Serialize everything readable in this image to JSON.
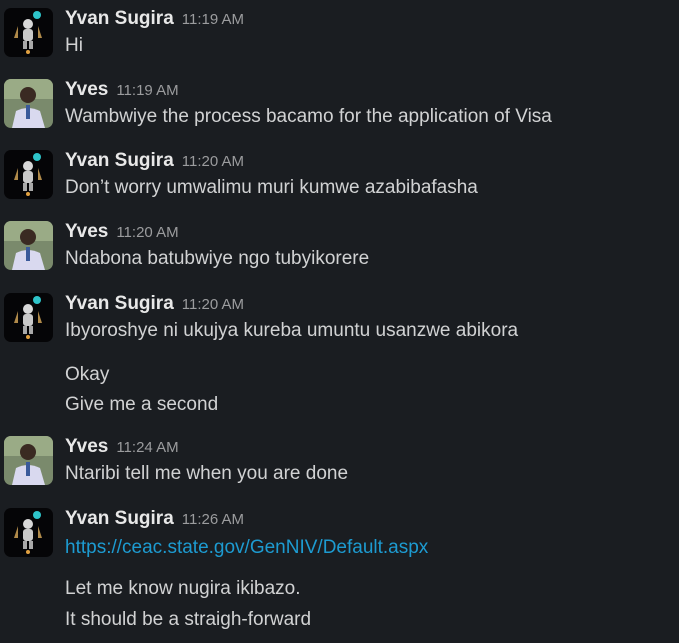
{
  "colors": {
    "background": "#1a1d21",
    "text": "#d1d2d3",
    "name": "#e8e8e8",
    "timestamp": "#9b9c9e",
    "link": "#1d9bd1"
  },
  "messages": [
    {
      "sender": "Yvan Sugira",
      "time": "11:19 AM",
      "avatar": "yvan-avatar",
      "lines": [
        "Hi"
      ]
    },
    {
      "sender": "Yves",
      "time": "11:19 AM",
      "avatar": "yves-avatar",
      "lines": [
        "Wambwiye the process bacamo for the application of Visa"
      ]
    },
    {
      "sender": "Yvan Sugira",
      "time": "11:20 AM",
      "avatar": "yvan-avatar",
      "lines": [
        "Don’t worry umwalimu muri kumwe azabibafasha"
      ]
    },
    {
      "sender": "Yves",
      "time": "11:20 AM",
      "avatar": "yves-avatar",
      "lines": [
        "Ndabona batubwiye ngo tubyikorere"
      ]
    },
    {
      "sender": "Yvan Sugira",
      "time": "11:20 AM",
      "avatar": "yvan-avatar",
      "lines": [
        "Ibyoroshye ni ukujya kureba umuntu usanzwe abikora"
      ]
    },
    {
      "continuation": true,
      "lines": [
        "Okay",
        "Give me a second"
      ]
    },
    {
      "sender": "Yves",
      "time": "11:24 AM",
      "avatar": "yves-avatar",
      "lines": [
        "Ntaribi tell me when you are done"
      ]
    },
    {
      "sender": "Yvan Sugira",
      "time": "11:26 AM",
      "avatar": "yvan-avatar",
      "link": "https://ceac.state.gov/GenNIV/Default.aspx"
    },
    {
      "continuation": true,
      "lines": [
        "Let me know nugira ikibazo.",
        "It should be a straigh-forward"
      ]
    }
  ]
}
